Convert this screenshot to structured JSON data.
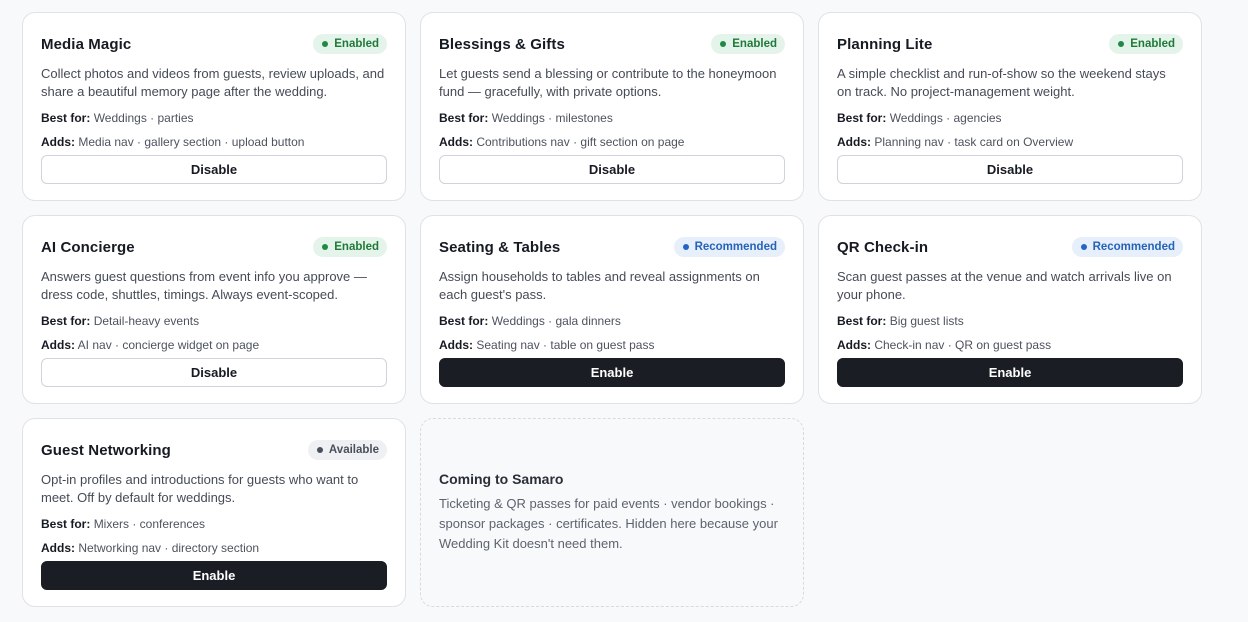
{
  "cards": [
    {
      "title": "Media Magic",
      "badge": "Enabled",
      "description": "Collect photos and videos from guests, review uploads, and share a beautiful memory page after the wedding.",
      "best_label": "Best for:",
      "best_for": "Weddings · parties",
      "adds_label": "Adds:",
      "adds": "Media nav · gallery section · upload button",
      "button": "Disable"
    },
    {
      "title": "Blessings & Gifts",
      "badge": "Enabled",
      "description": "Let guests send a blessing or contribute to the honeymoon fund — gracefully, with private options.",
      "best_label": "Best for:",
      "best_for": "Weddings · milestones",
      "adds_label": "Adds:",
      "adds": "Contributions nav · gift section on page",
      "button": "Disable"
    },
    {
      "title": "Planning Lite",
      "badge": "Enabled",
      "description": "A simple checklist and run-of-show so the weekend stays on track. No project-management weight.",
      "best_label": "Best for:",
      "best_for": "Weddings · agencies",
      "adds_label": "Adds:",
      "adds": "Planning nav · task card on Overview",
      "button": "Disable"
    },
    {
      "title": "AI Concierge",
      "badge": "Enabled",
      "description": "Answers guest questions from event info you approve — dress code, shuttles, timings. Always event-scoped.",
      "best_label": "Best for:",
      "best_for": "Detail-heavy events",
      "adds_label": "Adds:",
      "adds": "AI nav · concierge widget on page",
      "button": "Disable"
    },
    {
      "title": "Seating & Tables",
      "badge": "Recommended",
      "description": "Assign households to tables and reveal assignments on each guest's pass.",
      "best_label": "Best for:",
      "best_for": "Weddings · gala dinners",
      "adds_label": "Adds:",
      "adds": "Seating nav · table on guest pass",
      "button": "Enable"
    },
    {
      "title": "QR Check-in",
      "badge": "Recommended",
      "description": "Scan guest passes at the venue and watch arrivals live on your phone.",
      "best_label": "Best for:",
      "best_for": "Big guest lists",
      "adds_label": "Adds:",
      "adds": "Check-in nav · QR on guest pass",
      "button": "Enable"
    },
    {
      "title": "Guest Networking",
      "badge": "Available",
      "description": "Opt-in profiles and introductions for guests who want to meet. Off by default for weddings.",
      "best_label": "Best for:",
      "best_for": "Mixers · conferences",
      "adds_label": "Adds:",
      "adds": "Networking nav · directory section",
      "button": "Enable"
    }
  ],
  "coming_soon": {
    "title": "Coming to Samaro",
    "text": "Ticketing & QR passes for paid events · vendor bookings · sponsor packages · certificates. Hidden here because your Wedding Kit doesn't need them."
  }
}
